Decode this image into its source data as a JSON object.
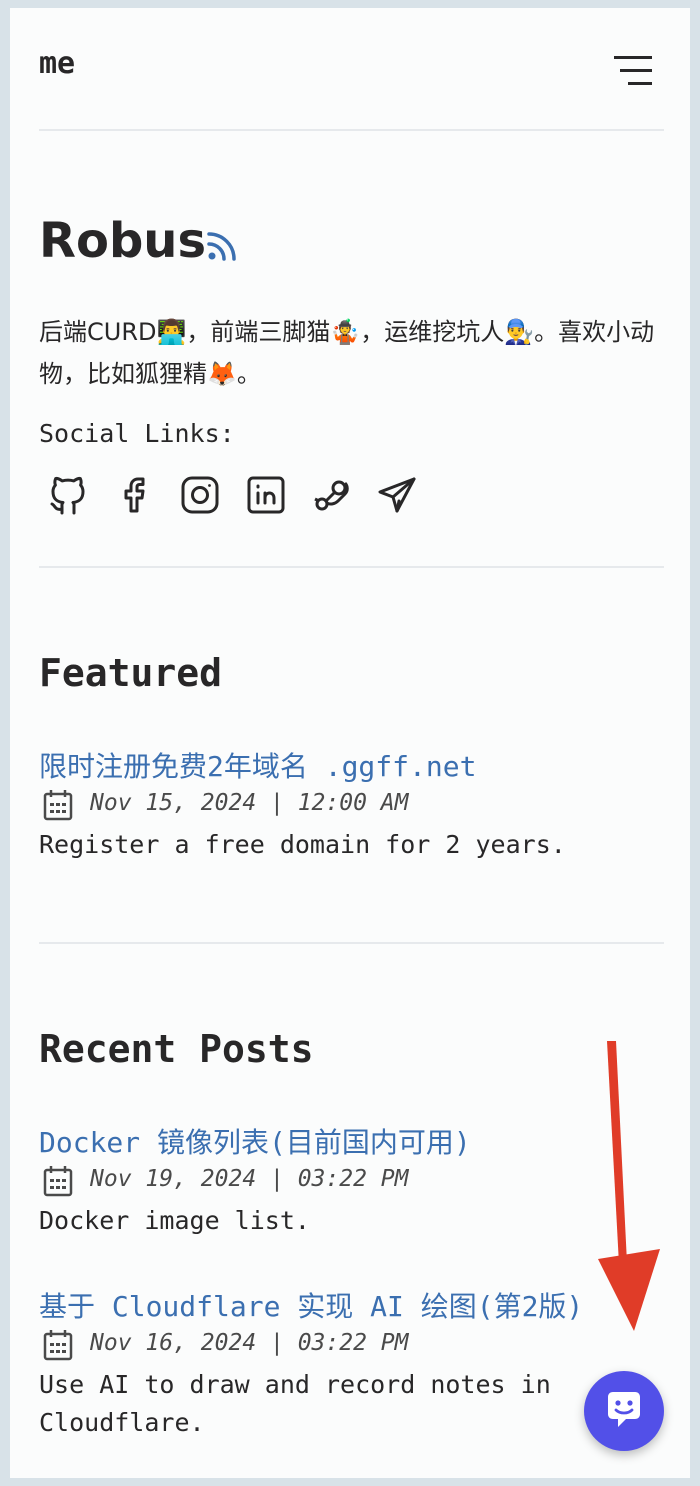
{
  "header": {
    "site_title": "me",
    "menu_icon": "hamburger-menu-icon"
  },
  "hero": {
    "title": "Robus",
    "rss_icon": "rss-icon",
    "bio": "后端CURD👨‍💻，前端三脚猫🤹，运维挖坑人👨‍🔧。喜欢小动物，比如狐狸精🦊。",
    "social_label": "Social Links:",
    "social_icons": [
      "github-icon",
      "facebook-icon",
      "instagram-icon",
      "linkedin-icon",
      "steam-icon",
      "telegram-icon"
    ]
  },
  "featured": {
    "heading": "Featured",
    "posts": [
      {
        "title": "限时注册免费2年域名 .ggff.net",
        "date": "Nov 15, 2024 | 12:00 AM",
        "description": "Register a free domain for 2 years."
      }
    ]
  },
  "recent": {
    "heading": "Recent Posts",
    "posts": [
      {
        "title": "Docker 镜像列表(目前国内可用)",
        "date": "Nov 19, 2024 | 03:22 PM",
        "description": "Docker image list."
      },
      {
        "title": "基于 Cloudflare 实现 AI 绘图(第2版)",
        "date": "Nov 16, 2024 | 03:22 PM",
        "description": "Use AI to draw and record notes in Cloudflare."
      }
    ]
  },
  "chat_widget": {
    "icon": "chat-bot-icon"
  },
  "colors": {
    "accent_link": "#3b6fb0",
    "chat_button": "#5250e8",
    "arrow": "#e03c28",
    "text": "#282728"
  }
}
